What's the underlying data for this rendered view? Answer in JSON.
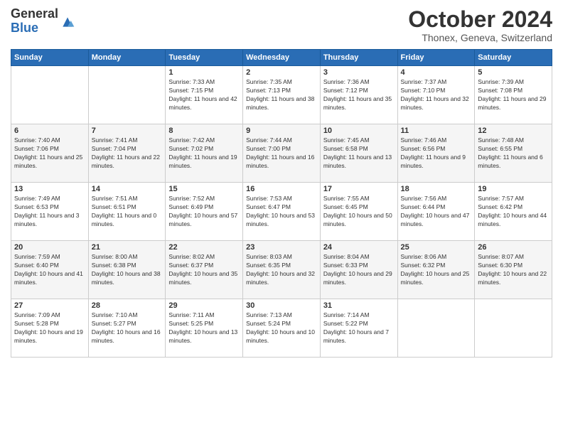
{
  "logo": {
    "general": "General",
    "blue": "Blue"
  },
  "header": {
    "month": "October 2024",
    "location": "Thonex, Geneva, Switzerland"
  },
  "days_of_week": [
    "Sunday",
    "Monday",
    "Tuesday",
    "Wednesday",
    "Thursday",
    "Friday",
    "Saturday"
  ],
  "weeks": [
    [
      {
        "day": "",
        "sunrise": "",
        "sunset": "",
        "daylight": ""
      },
      {
        "day": "",
        "sunrise": "",
        "sunset": "",
        "daylight": ""
      },
      {
        "day": "1",
        "sunrise": "Sunrise: 7:33 AM",
        "sunset": "Sunset: 7:15 PM",
        "daylight": "Daylight: 11 hours and 42 minutes."
      },
      {
        "day": "2",
        "sunrise": "Sunrise: 7:35 AM",
        "sunset": "Sunset: 7:13 PM",
        "daylight": "Daylight: 11 hours and 38 minutes."
      },
      {
        "day": "3",
        "sunrise": "Sunrise: 7:36 AM",
        "sunset": "Sunset: 7:12 PM",
        "daylight": "Daylight: 11 hours and 35 minutes."
      },
      {
        "day": "4",
        "sunrise": "Sunrise: 7:37 AM",
        "sunset": "Sunset: 7:10 PM",
        "daylight": "Daylight: 11 hours and 32 minutes."
      },
      {
        "day": "5",
        "sunrise": "Sunrise: 7:39 AM",
        "sunset": "Sunset: 7:08 PM",
        "daylight": "Daylight: 11 hours and 29 minutes."
      }
    ],
    [
      {
        "day": "6",
        "sunrise": "Sunrise: 7:40 AM",
        "sunset": "Sunset: 7:06 PM",
        "daylight": "Daylight: 11 hours and 25 minutes."
      },
      {
        "day": "7",
        "sunrise": "Sunrise: 7:41 AM",
        "sunset": "Sunset: 7:04 PM",
        "daylight": "Daylight: 11 hours and 22 minutes."
      },
      {
        "day": "8",
        "sunrise": "Sunrise: 7:42 AM",
        "sunset": "Sunset: 7:02 PM",
        "daylight": "Daylight: 11 hours and 19 minutes."
      },
      {
        "day": "9",
        "sunrise": "Sunrise: 7:44 AM",
        "sunset": "Sunset: 7:00 PM",
        "daylight": "Daylight: 11 hours and 16 minutes."
      },
      {
        "day": "10",
        "sunrise": "Sunrise: 7:45 AM",
        "sunset": "Sunset: 6:58 PM",
        "daylight": "Daylight: 11 hours and 13 minutes."
      },
      {
        "day": "11",
        "sunrise": "Sunrise: 7:46 AM",
        "sunset": "Sunset: 6:56 PM",
        "daylight": "Daylight: 11 hours and 9 minutes."
      },
      {
        "day": "12",
        "sunrise": "Sunrise: 7:48 AM",
        "sunset": "Sunset: 6:55 PM",
        "daylight": "Daylight: 11 hours and 6 minutes."
      }
    ],
    [
      {
        "day": "13",
        "sunrise": "Sunrise: 7:49 AM",
        "sunset": "Sunset: 6:53 PM",
        "daylight": "Daylight: 11 hours and 3 minutes."
      },
      {
        "day": "14",
        "sunrise": "Sunrise: 7:51 AM",
        "sunset": "Sunset: 6:51 PM",
        "daylight": "Daylight: 11 hours and 0 minutes."
      },
      {
        "day": "15",
        "sunrise": "Sunrise: 7:52 AM",
        "sunset": "Sunset: 6:49 PM",
        "daylight": "Daylight: 10 hours and 57 minutes."
      },
      {
        "day": "16",
        "sunrise": "Sunrise: 7:53 AM",
        "sunset": "Sunset: 6:47 PM",
        "daylight": "Daylight: 10 hours and 53 minutes."
      },
      {
        "day": "17",
        "sunrise": "Sunrise: 7:55 AM",
        "sunset": "Sunset: 6:45 PM",
        "daylight": "Daylight: 10 hours and 50 minutes."
      },
      {
        "day": "18",
        "sunrise": "Sunrise: 7:56 AM",
        "sunset": "Sunset: 6:44 PM",
        "daylight": "Daylight: 10 hours and 47 minutes."
      },
      {
        "day": "19",
        "sunrise": "Sunrise: 7:57 AM",
        "sunset": "Sunset: 6:42 PM",
        "daylight": "Daylight: 10 hours and 44 minutes."
      }
    ],
    [
      {
        "day": "20",
        "sunrise": "Sunrise: 7:59 AM",
        "sunset": "Sunset: 6:40 PM",
        "daylight": "Daylight: 10 hours and 41 minutes."
      },
      {
        "day": "21",
        "sunrise": "Sunrise: 8:00 AM",
        "sunset": "Sunset: 6:38 PM",
        "daylight": "Daylight: 10 hours and 38 minutes."
      },
      {
        "day": "22",
        "sunrise": "Sunrise: 8:02 AM",
        "sunset": "Sunset: 6:37 PM",
        "daylight": "Daylight: 10 hours and 35 minutes."
      },
      {
        "day": "23",
        "sunrise": "Sunrise: 8:03 AM",
        "sunset": "Sunset: 6:35 PM",
        "daylight": "Daylight: 10 hours and 32 minutes."
      },
      {
        "day": "24",
        "sunrise": "Sunrise: 8:04 AM",
        "sunset": "Sunset: 6:33 PM",
        "daylight": "Daylight: 10 hours and 29 minutes."
      },
      {
        "day": "25",
        "sunrise": "Sunrise: 8:06 AM",
        "sunset": "Sunset: 6:32 PM",
        "daylight": "Daylight: 10 hours and 25 minutes."
      },
      {
        "day": "26",
        "sunrise": "Sunrise: 8:07 AM",
        "sunset": "Sunset: 6:30 PM",
        "daylight": "Daylight: 10 hours and 22 minutes."
      }
    ],
    [
      {
        "day": "27",
        "sunrise": "Sunrise: 7:09 AM",
        "sunset": "Sunset: 5:28 PM",
        "daylight": "Daylight: 10 hours and 19 minutes."
      },
      {
        "day": "28",
        "sunrise": "Sunrise: 7:10 AM",
        "sunset": "Sunset: 5:27 PM",
        "daylight": "Daylight: 10 hours and 16 minutes."
      },
      {
        "day": "29",
        "sunrise": "Sunrise: 7:11 AM",
        "sunset": "Sunset: 5:25 PM",
        "daylight": "Daylight: 10 hours and 13 minutes."
      },
      {
        "day": "30",
        "sunrise": "Sunrise: 7:13 AM",
        "sunset": "Sunset: 5:24 PM",
        "daylight": "Daylight: 10 hours and 10 minutes."
      },
      {
        "day": "31",
        "sunrise": "Sunrise: 7:14 AM",
        "sunset": "Sunset: 5:22 PM",
        "daylight": "Daylight: 10 hours and 7 minutes."
      },
      {
        "day": "",
        "sunrise": "",
        "sunset": "",
        "daylight": ""
      },
      {
        "day": "",
        "sunrise": "",
        "sunset": "",
        "daylight": ""
      }
    ]
  ]
}
